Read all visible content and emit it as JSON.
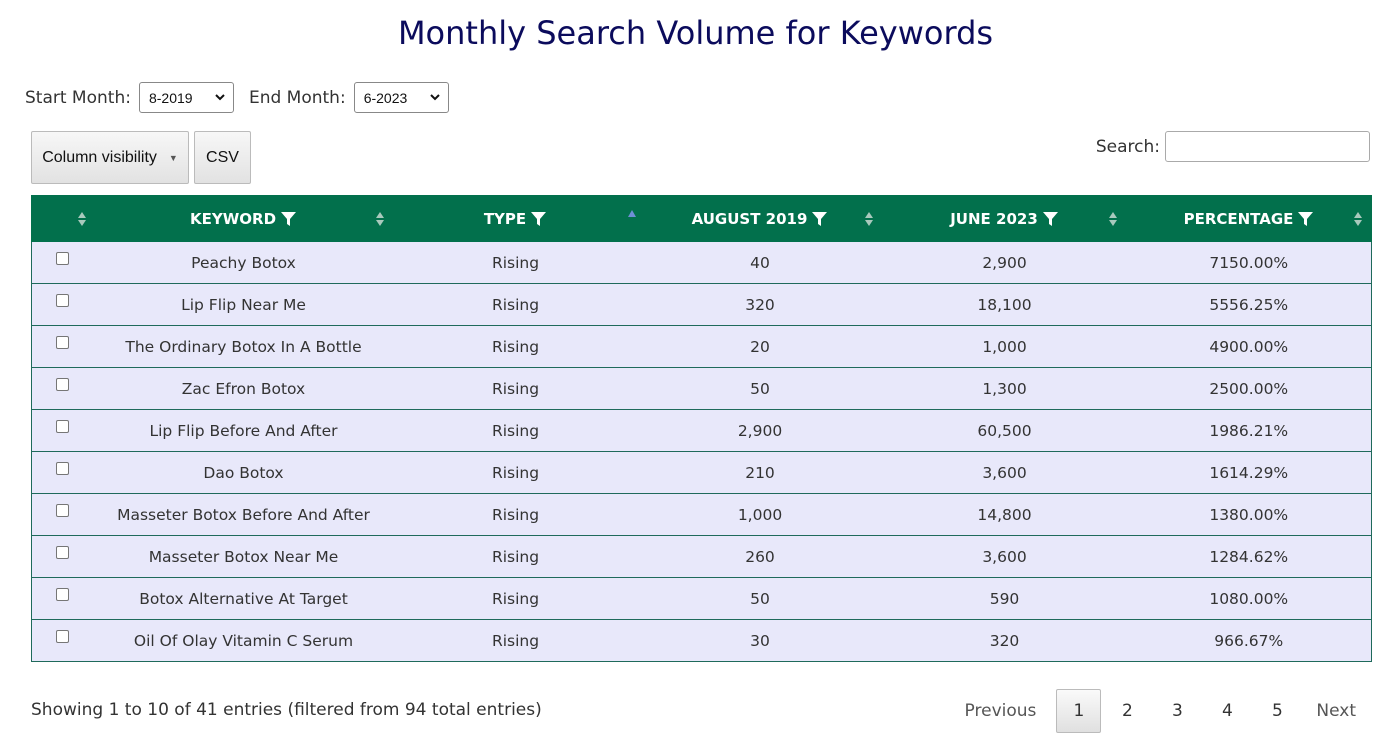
{
  "title": "Monthly Search Volume for Keywords",
  "filters": {
    "start_label": "Start Month:",
    "start_value": "8-2019",
    "end_label": "End Month:",
    "end_value": "6-2023"
  },
  "toolbar": {
    "colvis_label": "Column visibility",
    "csv_label": "CSV",
    "search_label": "Search:",
    "search_value": ""
  },
  "table": {
    "headers": [
      "KEYWORD",
      "TYPE",
      "AUGUST 2019",
      "JUNE 2023",
      "PERCENTAGE"
    ],
    "rows": [
      [
        "Peachy Botox",
        "Rising",
        "40",
        "2,900",
        "7150.00%"
      ],
      [
        "Lip Flip Near Me",
        "Rising",
        "320",
        "18,100",
        "5556.25%"
      ],
      [
        "The Ordinary Botox In A Bottle",
        "Rising",
        "20",
        "1,000",
        "4900.00%"
      ],
      [
        "Zac Efron Botox",
        "Rising",
        "50",
        "1,300",
        "2500.00%"
      ],
      [
        "Lip Flip Before And After",
        "Rising",
        "2,900",
        "60,500",
        "1986.21%"
      ],
      [
        "Dao Botox",
        "Rising",
        "210",
        "3,600",
        "1614.29%"
      ],
      [
        "Masseter Botox Before And After",
        "Rising",
        "1,000",
        "14,800",
        "1380.00%"
      ],
      [
        "Masseter Botox Near Me",
        "Rising",
        "260",
        "3,600",
        "1284.62%"
      ],
      [
        "Botox Alternative At Target",
        "Rising",
        "50",
        "590",
        "1080.00%"
      ],
      [
        "Oil Of Olay Vitamin C Serum",
        "Rising",
        "30",
        "320",
        "966.67%"
      ]
    ]
  },
  "footer": {
    "info": "Showing 1 to 10 of 41 entries (filtered from 94 total entries)",
    "previous": "Previous",
    "next": "Next",
    "pages": [
      "1",
      "2",
      "3",
      "4",
      "5"
    ],
    "active_page": "1"
  },
  "colors": {
    "header_bg": "#02704c",
    "row_bg": "#e8e8fa",
    "title": "#0b0b5c"
  }
}
